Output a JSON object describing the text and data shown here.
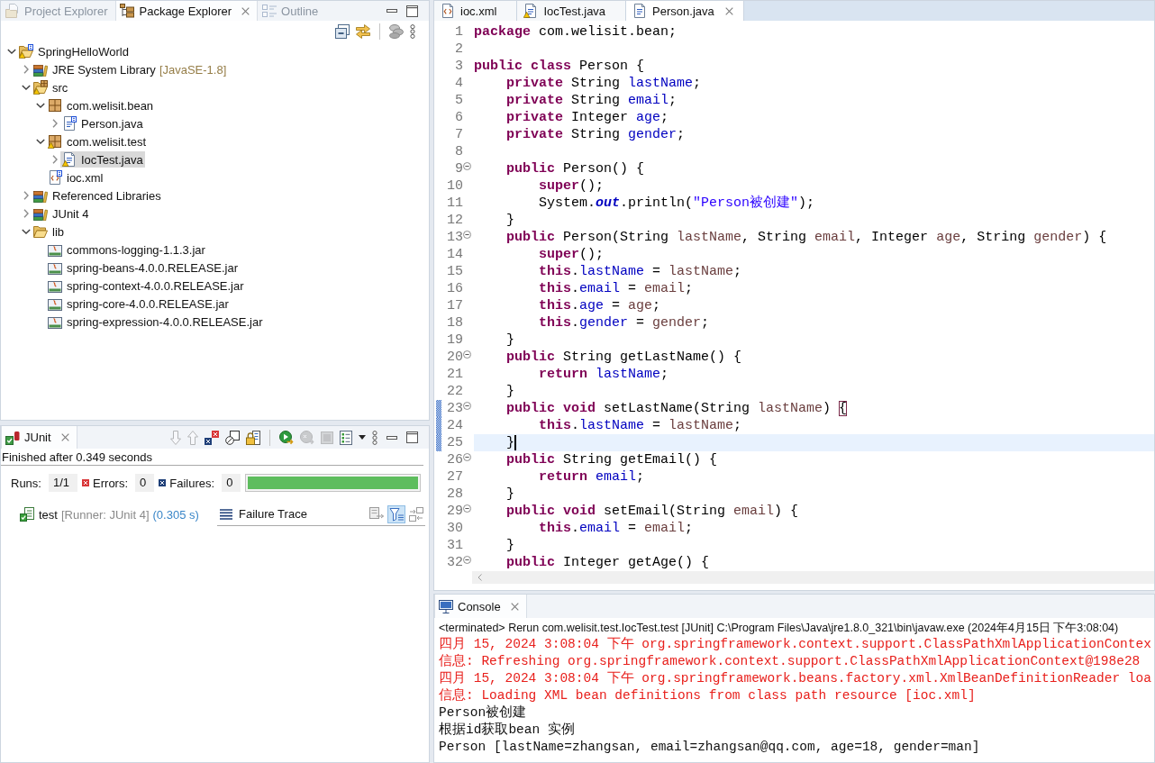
{
  "explorer": {
    "tabs": [
      {
        "label": "Project Explorer",
        "kind": "project-explorer",
        "selected": false
      },
      {
        "label": "Package Explorer",
        "kind": "package-explorer",
        "selected": true
      },
      {
        "label": "Outline",
        "kind": "outline",
        "selected": false
      }
    ],
    "toolbar_groups": [
      {
        "tools": [
          {
            "kind": "collapse-all"
          },
          {
            "kind": "link-editor"
          }
        ]
      },
      {
        "tools": [
          {
            "kind": "focus-task"
          },
          {
            "kind": "view-menu"
          }
        ]
      }
    ],
    "tree": [
      {
        "label": "SpringHelloWorld",
        "kind": "project",
        "expanded": true,
        "selected": false,
        "warning": true,
        "spring": true,
        "children": [
          {
            "label": "JRE System Library",
            "decoration": "[JavaSE-1.8]",
            "kind": "library",
            "expanded": false,
            "selected": false,
            "warning": false,
            "spring": false
          },
          {
            "label": "src",
            "kind": "source-folder",
            "expanded": true,
            "selected": false,
            "warning": true,
            "spring": false,
            "children": [
              {
                "label": "com.welisit.bean",
                "kind": "package",
                "expanded": true,
                "selected": false,
                "warning": false,
                "spring": false,
                "children": [
                  {
                    "label": "Person.java",
                    "kind": "java",
                    "expanded": false,
                    "selected": false,
                    "warning": false,
                    "spring": true
                  }
                ]
              },
              {
                "label": "com.welisit.test",
                "kind": "package",
                "expanded": true,
                "selected": false,
                "warning": true,
                "spring": false,
                "children": [
                  {
                    "label": "IocTest.java",
                    "kind": "java",
                    "expanded": false,
                    "selected": true,
                    "warning": true,
                    "spring": false
                  }
                ]
              },
              {
                "label": "ioc.xml",
                "kind": "xml",
                "selected": false,
                "warning": false,
                "spring": true
              }
            ]
          },
          {
            "label": "Referenced Libraries",
            "kind": "library",
            "expanded": false,
            "selected": false,
            "warning": false,
            "spring": false
          },
          {
            "label": "JUnit 4",
            "kind": "library",
            "expanded": false,
            "selected": false,
            "warning": false,
            "spring": false
          },
          {
            "label": "lib",
            "kind": "folder",
            "expanded": true,
            "selected": false,
            "warning": false,
            "spring": false,
            "children": [
              {
                "label": "commons-logging-1.1.3.jar",
                "kind": "jar",
                "selected": false,
                "warning": false,
                "spring": false
              },
              {
                "label": "spring-beans-4.0.0.RELEASE.jar",
                "kind": "jar",
                "selected": false,
                "warning": false,
                "spring": false
              },
              {
                "label": "spring-context-4.0.0.RELEASE.jar",
                "kind": "jar",
                "selected": false,
                "warning": false,
                "spring": false
              },
              {
                "label": "spring-core-4.0.0.RELEASE.jar",
                "kind": "jar",
                "selected": false,
                "warning": false,
                "spring": false
              },
              {
                "label": "spring-expression-4.0.0.RELEASE.jar",
                "kind": "jar",
                "selected": false,
                "warning": false,
                "spring": false
              }
            ]
          }
        ]
      }
    ]
  },
  "junit": {
    "tab": "JUnit",
    "toolbar_groups": [
      {
        "tools": [
          {
            "kind": "next-failure",
            "disabled": true
          },
          {
            "kind": "previous-failure",
            "disabled": true
          },
          {
            "kind": "failures-only",
            "disabled": false
          },
          {
            "kind": "skipped-only",
            "disabled": false
          },
          {
            "kind": "scroll-lock",
            "disabled": false
          }
        ]
      },
      {
        "tools": [
          {
            "kind": "rerun",
            "disabled": false
          },
          {
            "kind": "rerun-failed",
            "disabled": true
          },
          {
            "kind": "stop",
            "disabled": true
          },
          {
            "kind": "history",
            "disabled": false
          },
          {
            "kind": "history-menu",
            "disabled": false
          },
          {
            "kind": "view-menu",
            "disabled": false
          }
        ]
      }
    ],
    "status": "Finished after 0.349 seconds",
    "counters": [
      {
        "kind": "runs",
        "label": "Runs:",
        "value": "1/1"
      },
      {
        "kind": "errors",
        "label": "Errors:",
        "value": "0"
      },
      {
        "kind": "failures",
        "label": "Failures:",
        "value": "0"
      }
    ],
    "progress": {
      "level": 1,
      "failed": false
    },
    "tests": [
      {
        "kind": "passed",
        "name": "test",
        "runner": "[Runner: JUnit 4]",
        "time": "(0.305 s)"
      }
    ],
    "trace": {
      "title": "Failure Trace",
      "tools": [
        {
          "kind": "compare",
          "selected": false
        },
        {
          "kind": "filter",
          "selected": true
        },
        {
          "kind": "layout",
          "selected": false
        }
      ]
    }
  },
  "editor": {
    "tabs": [
      {
        "label": "ioc.xml",
        "kind": "xml",
        "warning": false,
        "selected": false
      },
      {
        "label": "IocTest.java",
        "kind": "java",
        "warning": true,
        "selected": false
      },
      {
        "label": "Person.java",
        "kind": "java",
        "warning": false,
        "selected": true
      }
    ],
    "lines": [
      {
        "number": "1",
        "fold": false,
        "changed": false,
        "current": false,
        "tokens": [
          {
            "kind": "keyword",
            "text": "package"
          },
          {
            "kind": "plain",
            "text": " com.welisit.bean;"
          }
        ]
      },
      {
        "number": "2",
        "fold": false,
        "changed": false,
        "current": false
      },
      {
        "number": "3",
        "fold": false,
        "changed": false,
        "current": false,
        "tokens": [
          {
            "kind": "keyword",
            "text": "public class"
          },
          {
            "kind": "plain",
            "text": " Person {"
          }
        ]
      },
      {
        "number": "4",
        "fold": false,
        "changed": false,
        "current": false,
        "tokens": [
          {
            "kind": "keyword",
            "text": "    private"
          },
          {
            "kind": "plain",
            "text": " String "
          },
          {
            "kind": "field",
            "text": "lastName"
          },
          {
            "kind": "plain",
            "text": ";"
          }
        ]
      },
      {
        "number": "5",
        "fold": false,
        "changed": false,
        "current": false,
        "tokens": [
          {
            "kind": "keyword",
            "text": "    private"
          },
          {
            "kind": "plain",
            "text": " String "
          },
          {
            "kind": "field",
            "text": "email"
          },
          {
            "kind": "plain",
            "text": ";"
          }
        ]
      },
      {
        "number": "6",
        "fold": false,
        "changed": false,
        "current": false,
        "tokens": [
          {
            "kind": "keyword",
            "text": "    private"
          },
          {
            "kind": "plain",
            "text": " Integer "
          },
          {
            "kind": "field",
            "text": "age"
          },
          {
            "kind": "plain",
            "text": ";"
          }
        ]
      },
      {
        "number": "7",
        "fold": false,
        "changed": false,
        "current": false,
        "tokens": [
          {
            "kind": "keyword",
            "text": "    private"
          },
          {
            "kind": "plain",
            "text": " String "
          },
          {
            "kind": "field",
            "text": "gender"
          },
          {
            "kind": "plain",
            "text": ";"
          }
        ]
      },
      {
        "number": "8",
        "fold": false,
        "changed": false,
        "current": false
      },
      {
        "number": "9",
        "fold": true,
        "changed": false,
        "current": false,
        "tokens": [
          {
            "kind": "keyword",
            "text": "    public"
          },
          {
            "kind": "plain",
            "text": " Person() {"
          }
        ]
      },
      {
        "number": "10",
        "fold": false,
        "changed": false,
        "current": false,
        "tokens": [
          {
            "kind": "keyword",
            "text": "        super"
          },
          {
            "kind": "plain",
            "text": "();"
          }
        ]
      },
      {
        "number": "11",
        "fold": false,
        "changed": false,
        "current": false,
        "tokens": [
          {
            "kind": "plain",
            "text": "        System."
          },
          {
            "kind": "static",
            "text": "out"
          },
          {
            "kind": "plain",
            "text": ".println("
          },
          {
            "kind": "string",
            "text": "\"Person被创建\""
          },
          {
            "kind": "plain",
            "text": ");"
          }
        ]
      },
      {
        "number": "12",
        "fold": false,
        "changed": false,
        "current": false,
        "tokens": [
          {
            "kind": "plain",
            "text": "    }"
          }
        ]
      },
      {
        "number": "13",
        "fold": true,
        "changed": false,
        "current": false,
        "tokens": [
          {
            "kind": "keyword",
            "text": "    public"
          },
          {
            "kind": "plain",
            "text": " Person(String "
          },
          {
            "kind": "local",
            "text": "lastName"
          },
          {
            "kind": "plain",
            "text": ", String "
          },
          {
            "kind": "local",
            "text": "email"
          },
          {
            "kind": "plain",
            "text": ", Integer "
          },
          {
            "kind": "local",
            "text": "age"
          },
          {
            "kind": "plain",
            "text": ", String "
          },
          {
            "kind": "local",
            "text": "gender"
          },
          {
            "kind": "plain",
            "text": ") {"
          }
        ]
      },
      {
        "number": "14",
        "fold": false,
        "changed": false,
        "current": false,
        "tokens": [
          {
            "kind": "keyword",
            "text": "        super"
          },
          {
            "kind": "plain",
            "text": "();"
          }
        ]
      },
      {
        "number": "15",
        "fold": false,
        "changed": false,
        "current": false,
        "tokens": [
          {
            "kind": "keyword",
            "text": "        this"
          },
          {
            "kind": "plain",
            "text": "."
          },
          {
            "kind": "field",
            "text": "lastName"
          },
          {
            "kind": "plain",
            "text": " = "
          },
          {
            "kind": "local",
            "text": "lastName"
          },
          {
            "kind": "plain",
            "text": ";"
          }
        ]
      },
      {
        "number": "16",
        "fold": false,
        "changed": false,
        "current": false,
        "tokens": [
          {
            "kind": "keyword",
            "text": "        this"
          },
          {
            "kind": "plain",
            "text": "."
          },
          {
            "kind": "field",
            "text": "email"
          },
          {
            "kind": "plain",
            "text": " = "
          },
          {
            "kind": "local",
            "text": "email"
          },
          {
            "kind": "plain",
            "text": ";"
          }
        ]
      },
      {
        "number": "17",
        "fold": false,
        "changed": false,
        "current": false,
        "tokens": [
          {
            "kind": "keyword",
            "text": "        this"
          },
          {
            "kind": "plain",
            "text": "."
          },
          {
            "kind": "field",
            "text": "age"
          },
          {
            "kind": "plain",
            "text": " = "
          },
          {
            "kind": "local",
            "text": "age"
          },
          {
            "kind": "plain",
            "text": ";"
          }
        ]
      },
      {
        "number": "18",
        "fold": false,
        "changed": false,
        "current": false,
        "tokens": [
          {
            "kind": "keyword",
            "text": "        this"
          },
          {
            "kind": "plain",
            "text": "."
          },
          {
            "kind": "field",
            "text": "gender"
          },
          {
            "kind": "plain",
            "text": " = "
          },
          {
            "kind": "local",
            "text": "gender"
          },
          {
            "kind": "plain",
            "text": ";"
          }
        ]
      },
      {
        "number": "19",
        "fold": false,
        "changed": false,
        "current": false,
        "tokens": [
          {
            "kind": "plain",
            "text": "    }"
          }
        ]
      },
      {
        "number": "20",
        "fold": true,
        "changed": false,
        "current": false,
        "tokens": [
          {
            "kind": "keyword",
            "text": "    public"
          },
          {
            "kind": "plain",
            "text": " String getLastName() {"
          }
        ]
      },
      {
        "number": "21",
        "fold": false,
        "changed": false,
        "current": false,
        "tokens": [
          {
            "kind": "keyword",
            "text": "        return "
          },
          {
            "kind": "field",
            "text": "lastName"
          },
          {
            "kind": "plain",
            "text": ";"
          }
        ]
      },
      {
        "number": "22",
        "fold": false,
        "changed": false,
        "current": false,
        "tokens": [
          {
            "kind": "plain",
            "text": "    }"
          }
        ]
      },
      {
        "number": "23",
        "fold": true,
        "changed": true,
        "current": false,
        "tokens": [
          {
            "kind": "keyword",
            "text": "    public void"
          },
          {
            "kind": "plain",
            "text": " setLastName(String "
          },
          {
            "kind": "local",
            "text": "lastName"
          },
          {
            "kind": "plain",
            "text": ") "
          },
          {
            "kind": "match",
            "text": "{"
          }
        ]
      },
      {
        "number": "24",
        "fold": false,
        "changed": true,
        "current": false,
        "tokens": [
          {
            "kind": "keyword",
            "text": "        this"
          },
          {
            "kind": "plain",
            "text": "."
          },
          {
            "kind": "field",
            "text": "lastName"
          },
          {
            "kind": "plain",
            "text": " = "
          },
          {
            "kind": "local",
            "text": "lastName"
          },
          {
            "kind": "plain",
            "text": ";"
          }
        ]
      },
      {
        "number": "25",
        "fold": false,
        "changed": true,
        "current": true,
        "tokens": [
          {
            "kind": "plain",
            "text": "    }"
          }
        ]
      },
      {
        "number": "26",
        "fold": true,
        "changed": false,
        "current": false,
        "tokens": [
          {
            "kind": "keyword",
            "text": "    public"
          },
          {
            "kind": "plain",
            "text": " String getEmail() {"
          }
        ]
      },
      {
        "number": "27",
        "fold": false,
        "changed": false,
        "current": false,
        "tokens": [
          {
            "kind": "keyword",
            "text": "        return "
          },
          {
            "kind": "field",
            "text": "email"
          },
          {
            "kind": "plain",
            "text": ";"
          }
        ]
      },
      {
        "number": "28",
        "fold": false,
        "changed": false,
        "current": false,
        "tokens": [
          {
            "kind": "plain",
            "text": "    }"
          }
        ]
      },
      {
        "number": "29",
        "fold": true,
        "changed": false,
        "current": false,
        "tokens": [
          {
            "kind": "keyword",
            "text": "    public void"
          },
          {
            "kind": "plain",
            "text": " setEmail(String "
          },
          {
            "kind": "local",
            "text": "email"
          },
          {
            "kind": "plain",
            "text": ") {"
          }
        ]
      },
      {
        "number": "30",
        "fold": false,
        "changed": false,
        "current": false,
        "tokens": [
          {
            "kind": "keyword",
            "text": "        this"
          },
          {
            "kind": "plain",
            "text": "."
          },
          {
            "kind": "field",
            "text": "email"
          },
          {
            "kind": "plain",
            "text": " = "
          },
          {
            "kind": "local",
            "text": "email"
          },
          {
            "kind": "plain",
            "text": ";"
          }
        ]
      },
      {
        "number": "31",
        "fold": false,
        "changed": false,
        "current": false,
        "tokens": [
          {
            "kind": "plain",
            "text": "    }"
          }
        ]
      },
      {
        "number": "32",
        "fold": true,
        "changed": false,
        "current": false,
        "tokens": [
          {
            "kind": "keyword",
            "text": "    public"
          },
          {
            "kind": "plain",
            "text": " Integer getAge() {"
          }
        ]
      }
    ]
  },
  "console": {
    "tab": "Console",
    "header": "<terminated> Rerun com.welisit.test.IocTest.test [JUnit] C:\\Program Files\\Java\\jre1.8.0_321\\bin\\javaw.exe (2024年4月15日 下午3:08:04)",
    "lines": [
      {
        "kind": "stderr",
        "text": "四月 15, 2024 3:08:04 下午 org.springframework.context.support.ClassPathXmlApplicationContex"
      },
      {
        "kind": "stderr",
        "text": "信息: Refreshing org.springframework.context.support.ClassPathXmlApplicationContext@198e28"
      },
      {
        "kind": "stderr",
        "text": "四月 15, 2024 3:08:04 下午 org.springframework.beans.factory.xml.XmlBeanDefinitionReader loa"
      },
      {
        "kind": "stderr",
        "text": "信息: Loading XML bean definitions from class path resource [ioc.xml]"
      },
      {
        "kind": "stdout",
        "text": "Person被创建"
      },
      {
        "kind": "stdout",
        "text": "根据id获取bean 实例"
      },
      {
        "kind": "stdout",
        "text": "Person [lastName=zhangsan, email=zhangsan@qq.com, age=18, gender=man]"
      }
    ]
  }
}
